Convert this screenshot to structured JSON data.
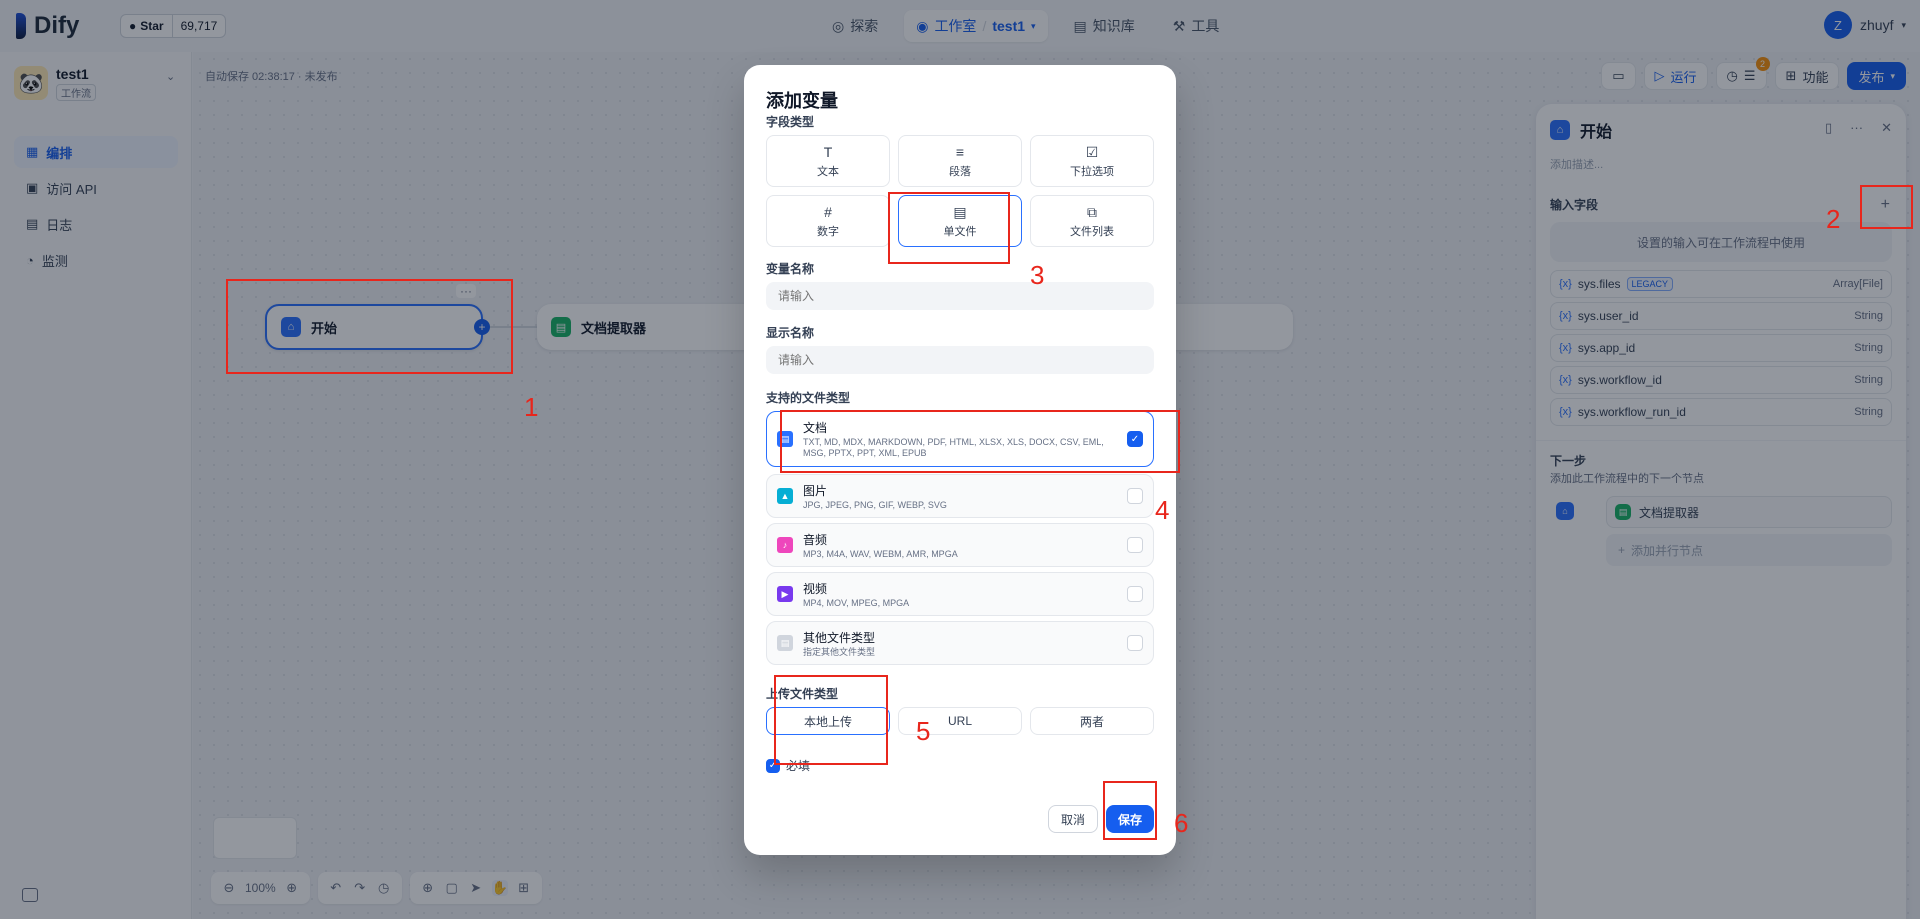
{
  "header": {
    "logo_text": "Dify",
    "github_star_label": "Star",
    "github_star_count": "69,717",
    "nav": [
      {
        "label": "探索"
      },
      {
        "label": "工作室"
      },
      {
        "label": "test1"
      },
      {
        "label": "知识库"
      },
      {
        "label": "工具"
      }
    ],
    "user_initial": "Z",
    "user_name": "zhuyf"
  },
  "sidebar": {
    "app_name": "test1",
    "app_type": "工作流",
    "items": [
      {
        "label": "编排"
      },
      {
        "label": "访问 API"
      },
      {
        "label": "日志"
      },
      {
        "label": "监测"
      }
    ]
  },
  "canvas": {
    "autosave": "自动保存 02:38:17 · 未发布",
    "start_node": "开始",
    "extract_node": "文档提取器",
    "zoom": "100%"
  },
  "topright": {
    "run": "运行",
    "features": "功能",
    "publish": "发布",
    "badge": "2"
  },
  "panel": {
    "title": "开始",
    "description": "添加描述...",
    "input_fields": "输入字段",
    "tip": "设置的输入可在工作流程中使用",
    "vars": [
      {
        "name": "sys.files",
        "legacy": "LEGACY",
        "type": "Array[File]"
      },
      {
        "name": "sys.user_id",
        "type": "String"
      },
      {
        "name": "sys.app_id",
        "type": "String"
      },
      {
        "name": "sys.workflow_id",
        "type": "String"
      },
      {
        "name": "sys.workflow_run_id",
        "type": "String"
      }
    ],
    "next_step": "下一步",
    "next_desc": "添加此工作流程中的下一个节点",
    "next_node": "文档提取器",
    "add_parallel": "添加并行节点"
  },
  "modal": {
    "title": "添加变量",
    "field_type_label": "字段类型",
    "types": [
      {
        "label": "文本",
        "icon": "text-icon"
      },
      {
        "label": "段落",
        "icon": "paragraph-icon"
      },
      {
        "label": "下拉选项",
        "icon": "select-icon"
      },
      {
        "label": "数字",
        "icon": "number-icon"
      },
      {
        "label": "单文件",
        "icon": "file-icon"
      },
      {
        "label": "文件列表",
        "icon": "file-list-icon"
      }
    ],
    "var_name_label": "变量名称",
    "var_name_placeholder": "请输入",
    "display_name_label": "显示名称",
    "display_name_placeholder": "请输入",
    "file_types_label": "支持的文件类型",
    "file_types": [
      {
        "name": "文档",
        "ext": "TXT, MD, MDX, MARKDOWN, PDF, HTML, XLSX, XLS, DOCX, CSV, EML, MSG, PPTX, PPT, XML, EPUB",
        "checked": true,
        "color": "#2970ff"
      },
      {
        "name": "图片",
        "ext": "JPG, JPEG, PNG, GIF, WEBP, SVG",
        "checked": false,
        "color": "#06aed4"
      },
      {
        "name": "音频",
        "ext": "MP3, M4A, WAV, WEBM, AMR, MPGA",
        "checked": false,
        "color": "#ee46bc"
      },
      {
        "name": "视频",
        "ext": "MP4, MOV, MPEG, MPGA",
        "checked": false,
        "color": "#7839ee"
      },
      {
        "name": "其他文件类型",
        "ext": "指定其他文件类型",
        "checked": false,
        "color": "#d0d5dd"
      }
    ],
    "upload_label": "上传文件类型",
    "upload_options": [
      "本地上传",
      "URL",
      "两者"
    ],
    "required": "必填",
    "cancel": "取消",
    "save": "保存"
  },
  "annotations": [
    "1",
    "2",
    "3",
    "4",
    "5",
    "6"
  ],
  "colors": {
    "accent": "#155eef",
    "annotation": "#e8261c"
  }
}
